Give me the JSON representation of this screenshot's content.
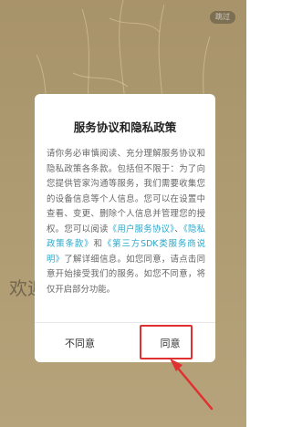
{
  "skip_label": "跳过",
  "welcome_text": "欢迎",
  "dialog": {
    "title": "服务协议和隐私政策",
    "body_1": "请你务必审慎阅读、充分理解服务协议和隐私政策各条款。包括但不限于：为了向您提供管家沟通等服务，我们需要收集您的设备信息等个人信息。您可以在设置中查看、变更、删除个人信息并管理您的授权。您可以阅读",
    "link_user": "《用户服务协议》",
    "sep_1": "、",
    "link_privacy": "《隐私政策条款》",
    "sep_2": "和",
    "link_sdk": "《第三方SDK类服务商说明》",
    "body_2": "了解详细信息。如您同意，请点击同意开始接受我们的服务。如您不同意，将仅开启部分功能。",
    "disagree_label": "不同意",
    "agree_label": "同意"
  },
  "colors": {
    "link": "#2aa6c8",
    "highlight": "#e03030",
    "arrow": "#e03030"
  }
}
